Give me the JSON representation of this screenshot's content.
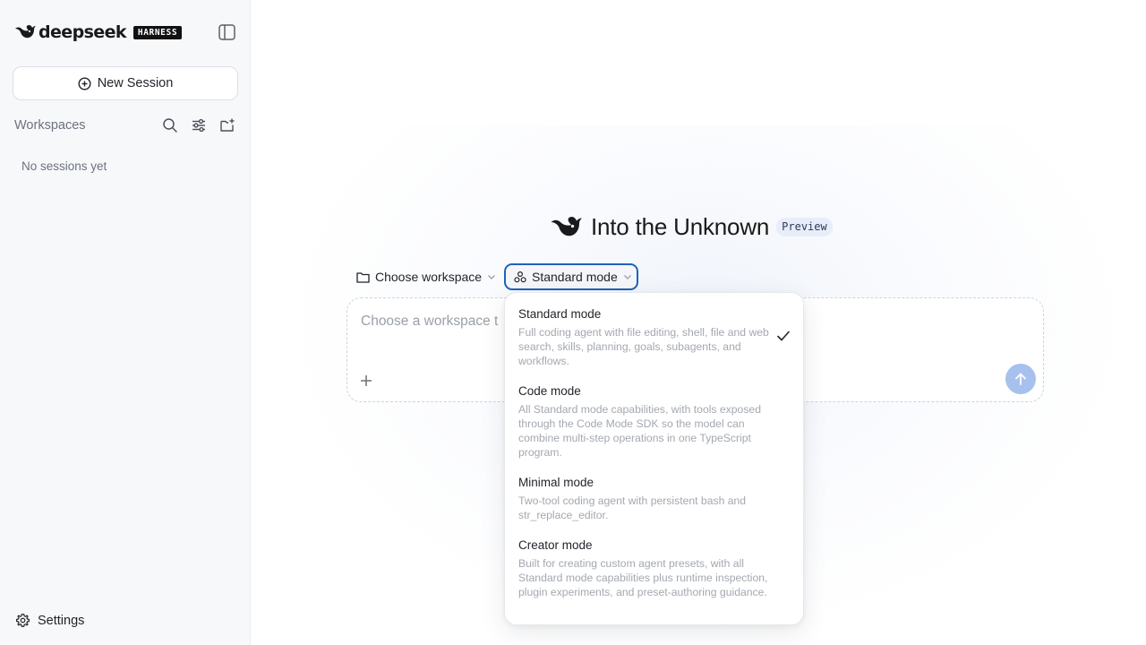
{
  "sidebar": {
    "brand_name": "deepseek",
    "brand_badge": "HARNESS",
    "new_session_label": "New Session",
    "workspaces_label": "Workspaces",
    "empty_label": "No sessions yet",
    "settings_label": "Settings"
  },
  "hero": {
    "title": "Into the Unknown",
    "badge": "Preview"
  },
  "composer": {
    "workspace_label": "Choose workspace",
    "mode_label": "Standard mode",
    "placeholder": "Choose a workspace t"
  },
  "mode_menu": {
    "selected": "Standard mode",
    "options": [
      {
        "title": "Standard mode",
        "desc": "Full coding agent with file editing, shell, file and web search, skills, planning, goals, subagents, and workflows."
      },
      {
        "title": "Code mode",
        "desc": "All Standard mode capabilities, with tools exposed through the Code Mode SDK so the model can combine multi-step operations in one TypeScript program."
      },
      {
        "title": "Minimal mode",
        "desc": "Two-tool coding agent with persistent bash and str_replace_editor."
      },
      {
        "title": "Creator mode",
        "desc": "Built for creating custom agent presets, with all Standard mode capabilities plus runtime inspection, plugin experiments, and preset-authoring guidance."
      }
    ]
  },
  "icons": {
    "brand": "whale-logo-icon",
    "sidebar_toggle": "sidebar-toggle-icon",
    "new_session": "plus-circle-icon",
    "search": "search-icon",
    "filter": "sliders-icon",
    "new_workspace": "folder-plus-icon",
    "settings": "gear-icon",
    "folder": "folder-icon",
    "mode": "mode-icon",
    "chevron": "chevron-down-icon",
    "add": "plus-icon",
    "send": "arrow-up-icon",
    "check": "check-icon"
  },
  "colors": {
    "accent": "#1f63b8",
    "send_button": "#a7c1ee",
    "sidebar_bg": "#f7f8fa",
    "badge_bg": "#e7edf9"
  }
}
